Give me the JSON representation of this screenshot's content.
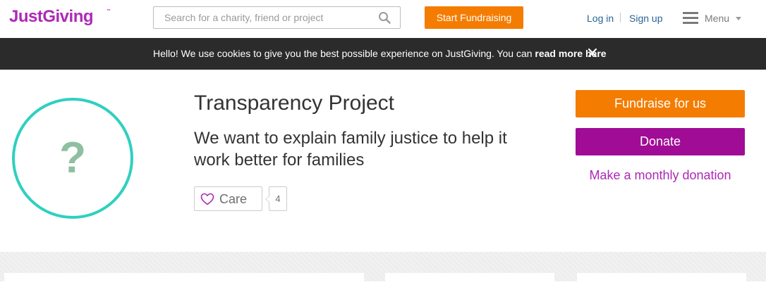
{
  "header": {
    "logo_text": "JustGiving",
    "logo_tm": "™",
    "brand_color": "#ad29b6",
    "search": {
      "placeholder": "Search for a charity, friend or project",
      "value": "",
      "icon": "search-icon"
    },
    "start_fundraising_label": "Start Fundraising",
    "login_label": "Log in",
    "signup_label": "Sign up",
    "menu_label": "Menu",
    "menu_icon": "hamburger-icon"
  },
  "cookie_banner": {
    "text": "Hello! We use cookies to give you the best possible experience on JustGiving. You can ",
    "link_label": "read more here",
    "close_icon": "close-icon"
  },
  "profile": {
    "avatar_placeholder": "?",
    "avatar_ring_color": "#2fd0c0",
    "title": "Transparency Project",
    "tagline": "We want to explain family justice to help it work better for families",
    "care_label": "Care",
    "care_count": "4",
    "care_icon": "heart-icon",
    "fundraise_label": "Fundraise for us",
    "donate_label": "Donate",
    "monthly_label": "Make a monthly donation"
  },
  "colors": {
    "orange": "#f47c00",
    "purple": "#a00c96",
    "link_blue": "#2a6496",
    "banner_bg": "#2b2b2b"
  }
}
